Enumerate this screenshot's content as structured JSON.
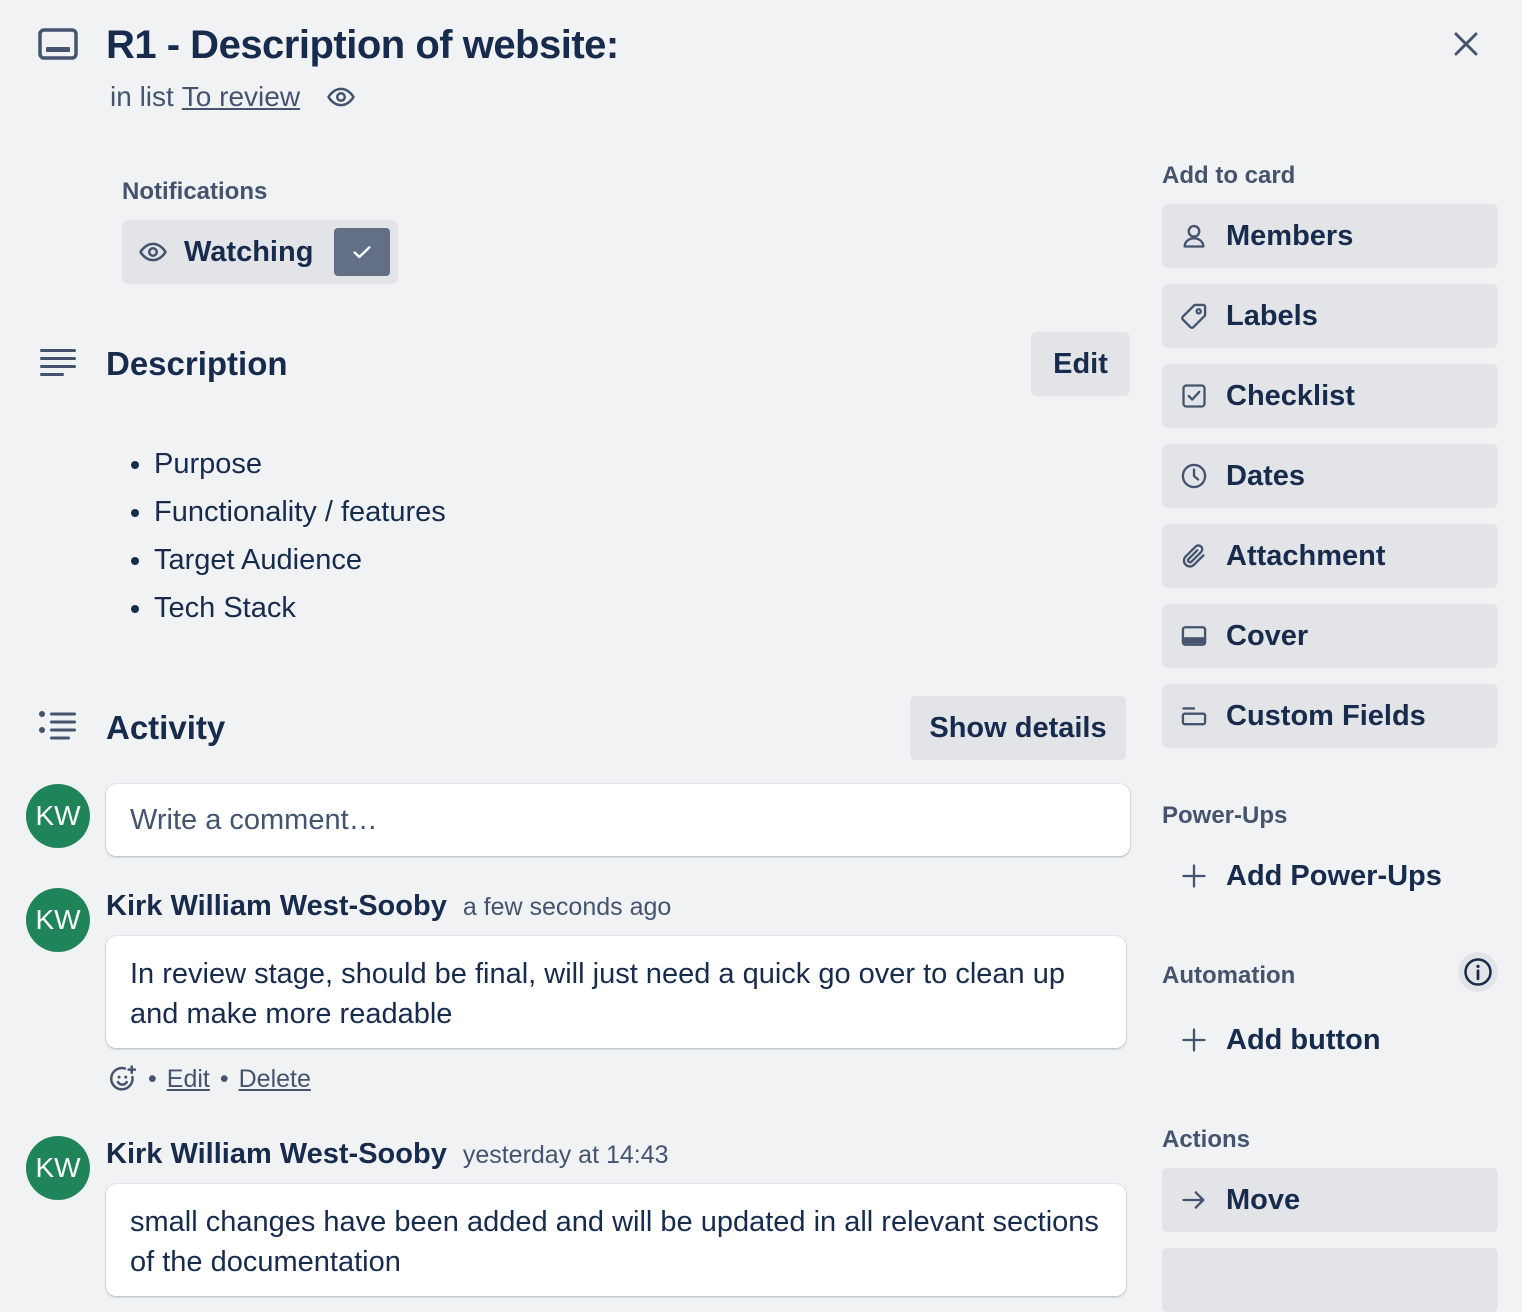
{
  "card": {
    "title": "R1 - Description of website:",
    "list_prefix": "in list",
    "list_name": "To review"
  },
  "notifications": {
    "label": "Notifications",
    "watch_label": "Watching"
  },
  "description": {
    "title": "Description",
    "edit_label": "Edit",
    "items": [
      "Purpose",
      "Functionality / features",
      "Target Audience",
      "Tech Stack"
    ]
  },
  "activity": {
    "title": "Activity",
    "show_details_label": "Show details",
    "comment_placeholder": "Write a comment…",
    "avatar_initials": "KW",
    "comments": [
      {
        "initials": "KW",
        "author": "Kirk William West-Sooby",
        "time": "a few seconds ago",
        "text": "In review stage, should be final, will just need a quick go over to clean up and make more readable",
        "edit_label": "Edit",
        "delete_label": "Delete",
        "separator": "•"
      },
      {
        "initials": "KW",
        "author": "Kirk William West-Sooby",
        "time": "yesterday at 14:43",
        "text": "small changes have been added and will be updated in all relevant sections of the documentation"
      }
    ]
  },
  "sidebar": {
    "add_to_card_label": "Add to card",
    "add_to_card": [
      {
        "label": "Members",
        "icon": "person-icon"
      },
      {
        "label": "Labels",
        "icon": "tag-icon"
      },
      {
        "label": "Checklist",
        "icon": "checkbox-icon"
      },
      {
        "label": "Dates",
        "icon": "clock-icon"
      },
      {
        "label": "Attachment",
        "icon": "paperclip-icon"
      },
      {
        "label": "Cover",
        "icon": "cover-icon"
      },
      {
        "label": "Custom Fields",
        "icon": "custom-fields-icon"
      }
    ],
    "power_ups_label": "Power-Ups",
    "add_power_ups_label": "Add Power-Ups",
    "automation_label": "Automation",
    "add_button_label": "Add button",
    "actions_label": "Actions",
    "move_label": "Move"
  },
  "colors": {
    "background": "#f1f2f4",
    "button_bg": "#e2e4e8",
    "avatar": "#1f845a",
    "text": "#172b4d",
    "subtle_text": "#44546f"
  }
}
